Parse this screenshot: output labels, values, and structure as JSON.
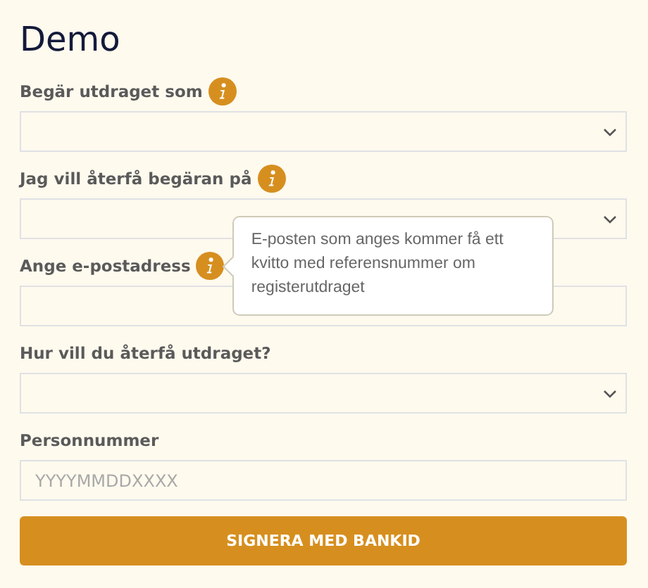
{
  "title": "Demo",
  "fields": [
    {
      "kind": "select",
      "label": "Begär utdraget som",
      "info": true
    },
    {
      "kind": "select",
      "label": "Jag vill återfå begäran på",
      "info": true
    },
    {
      "kind": "text",
      "label": "Ange e-postadress",
      "info": true,
      "tooltip": "E-posten som anges kommer få ett kvitto med referensnummer om registerutdraget"
    },
    {
      "kind": "select",
      "label": "Hur vill du återfå utdraget?",
      "info": false
    },
    {
      "kind": "text",
      "label": "Personnummer",
      "info": false,
      "placeholder": "YYYYMMDDXXXX"
    }
  ],
  "button": "SIGNERA MED BANKID"
}
